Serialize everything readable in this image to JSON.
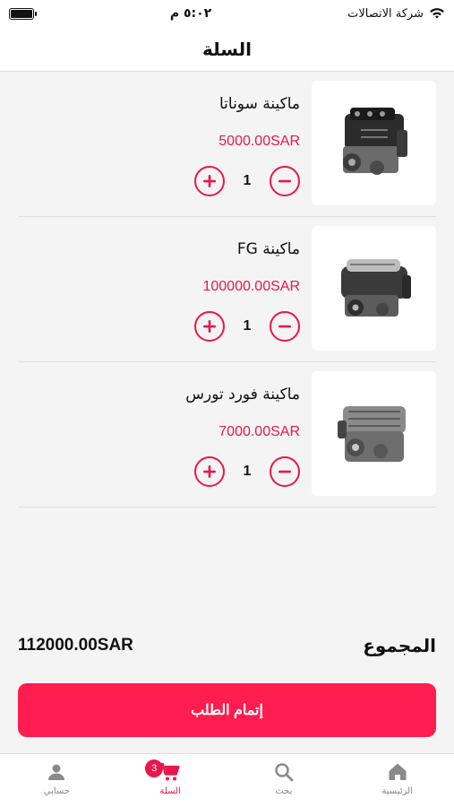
{
  "status_bar": {
    "carrier": "شركة الاتصالات",
    "time": "٥:٠٢ م"
  },
  "header": {
    "title": "السلة"
  },
  "cart": {
    "items": [
      {
        "name": "ماكينة سوناتا",
        "price": "5000.00SAR",
        "quantity": "1",
        "image_icon": "engine-image"
      },
      {
        "name": "ماكينة FG",
        "price": "100000.00SAR",
        "quantity": "1",
        "image_icon": "engine-image"
      },
      {
        "name": "ماكينة فورد تورس",
        "price": "7000.00SAR",
        "quantity": "1",
        "image_icon": "engine-image"
      }
    ],
    "total_label": "المجموع",
    "total_value": "112000.00SAR",
    "checkout_label": "إتمام الطلب"
  },
  "tab_bar": {
    "tabs": [
      {
        "label": "الرئيسية",
        "icon": "home-icon"
      },
      {
        "label": "بحث",
        "icon": "search-icon"
      },
      {
        "label": "السلة",
        "icon": "cart-icon",
        "badge": "3",
        "active": true
      },
      {
        "label": "حسابي",
        "icon": "user-icon"
      }
    ]
  },
  "colors": {
    "accent": "#e8174a",
    "button": "#ff1c4e",
    "background": "#f4f4f4"
  }
}
